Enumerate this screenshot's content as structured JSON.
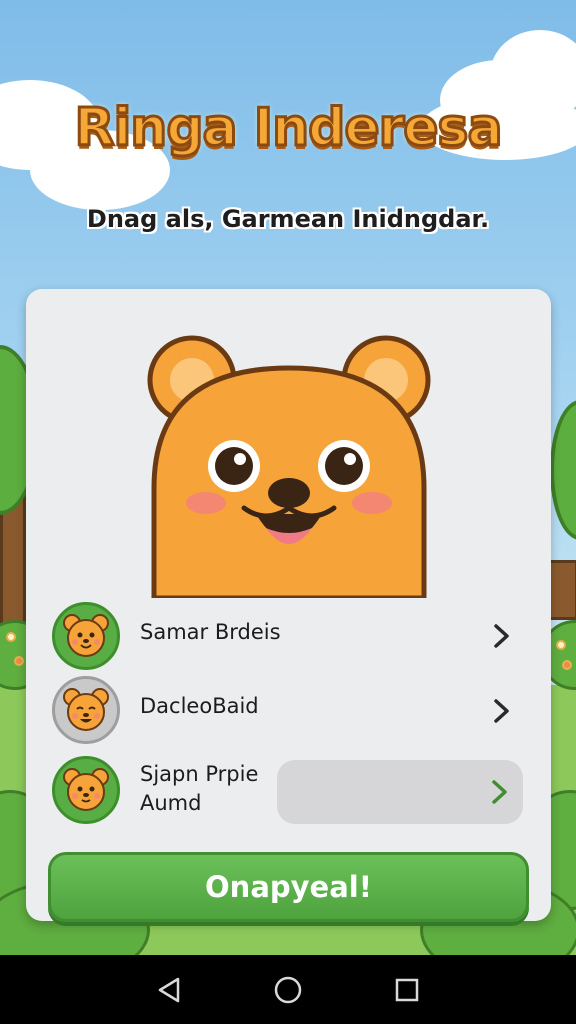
{
  "title": "Ringa Inderesa",
  "subtitle": "Dnag als, Garmean Inidngdar.",
  "characters": [
    {
      "name": "Samar Brdeis",
      "avatar": "bear-face-icon",
      "avatar_bg": "green"
    },
    {
      "name": "DacleoBaid",
      "avatar": "bear-face-icon",
      "avatar_bg": "gray"
    },
    {
      "name": "Sjapn Prpie Aumd",
      "avatar": "bear-face-icon",
      "avatar_bg": "green",
      "selected": true
    }
  ],
  "play_button_label": "Onapyeal!",
  "navbar": {
    "icons": [
      "back-triangle-icon",
      "home-circle-icon",
      "recents-square-icon"
    ]
  },
  "colors": {
    "accent_green": "#4fa33e",
    "title_orange": "#f6a836",
    "bear_orange": "#f6a33a"
  }
}
